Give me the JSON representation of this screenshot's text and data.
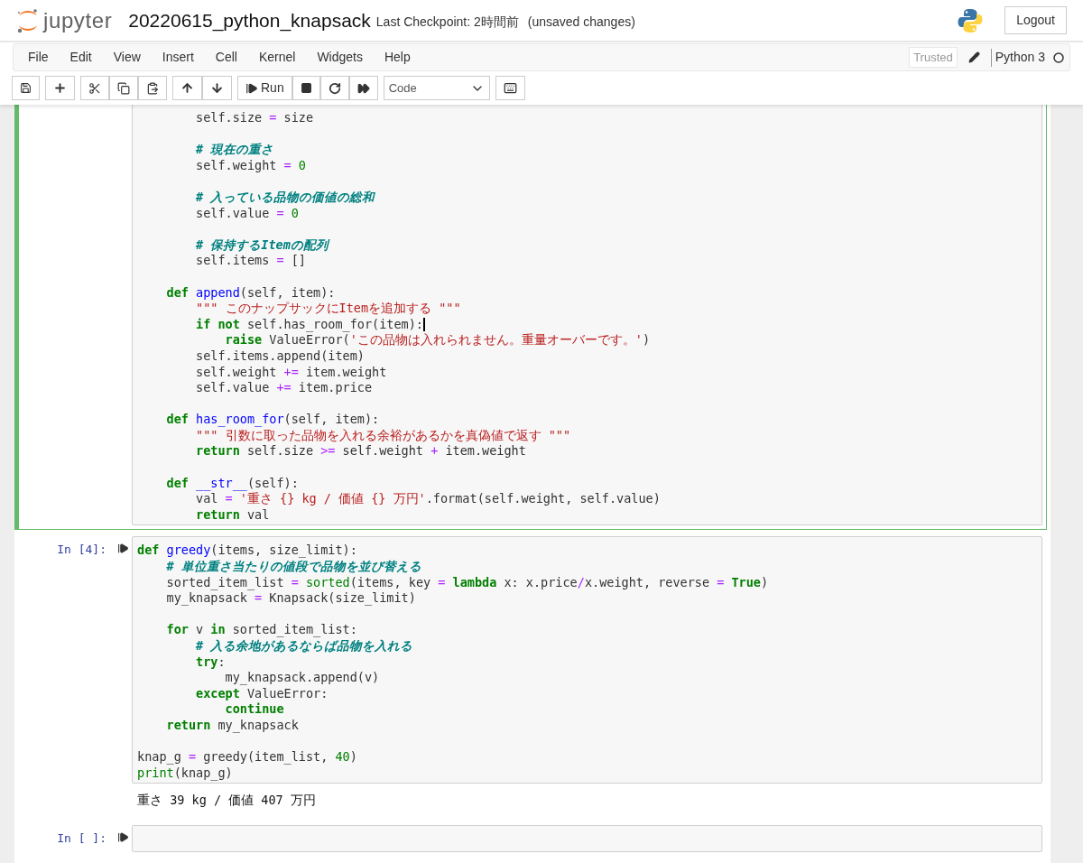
{
  "header": {
    "logo_text": "jupyter",
    "notebook_name": "20220615_python_knapsack",
    "checkpoint": "Last Checkpoint: 2時間前",
    "unsaved": "(unsaved changes)",
    "logout": "Logout"
  },
  "menu": {
    "items": [
      "File",
      "Edit",
      "View",
      "Insert",
      "Cell",
      "Kernel",
      "Widgets",
      "Help"
    ],
    "trusted": "Trusted",
    "kernel_name": "Python 3"
  },
  "toolbar": {
    "run_label": "Run",
    "cell_type": "Code"
  },
  "cells": [
    {
      "selected": true,
      "lines": [
        {
          "kind": "code",
          "tokens": [
            {
              "kind": "plain",
              "text": "        self.size "
            },
            {
              "kind": "op",
              "text": "="
            },
            {
              "kind": "plain",
              "text": " size"
            }
          ]
        },
        {
          "kind": "blank"
        },
        {
          "kind": "code",
          "tokens": [
            {
              "kind": "comment",
              "text": "        # 現在の重さ"
            }
          ]
        },
        {
          "kind": "code",
          "tokens": [
            {
              "kind": "plain",
              "text": "        self.weight "
            },
            {
              "kind": "op",
              "text": "="
            },
            {
              "kind": "num",
              "text": " 0"
            }
          ]
        },
        {
          "kind": "blank"
        },
        {
          "kind": "code",
          "tokens": [
            {
              "kind": "comment",
              "text": "        # 入っている品物の価値の総和"
            }
          ]
        },
        {
          "kind": "code",
          "tokens": [
            {
              "kind": "plain",
              "text": "        self.value "
            },
            {
              "kind": "op",
              "text": "="
            },
            {
              "kind": "num",
              "text": " 0"
            }
          ]
        },
        {
          "kind": "blank"
        },
        {
          "kind": "code",
          "tokens": [
            {
              "kind": "comment",
              "text": "        # 保持するItemの配列"
            }
          ]
        },
        {
          "kind": "code",
          "tokens": [
            {
              "kind": "plain",
              "text": "        self.items "
            },
            {
              "kind": "op",
              "text": "="
            },
            {
              "kind": "plain",
              "text": " []"
            }
          ]
        },
        {
          "kind": "blank"
        },
        {
          "kind": "code",
          "tokens": [
            {
              "kind": "kw",
              "text": "    def"
            },
            {
              "kind": "def",
              "text": " append"
            },
            {
              "kind": "plain",
              "text": "(self, item):"
            }
          ]
        },
        {
          "kind": "code",
          "tokens": [
            {
              "kind": "str",
              "text": "        \"\"\" このナップサックにItemを追加する \"\"\""
            }
          ]
        },
        {
          "kind": "code",
          "cursor": true,
          "tokens": [
            {
              "kind": "kw",
              "text": "        if"
            },
            {
              "kind": "kw",
              "text": " not"
            },
            {
              "kind": "plain",
              "text": " self.has_room_for(item):"
            }
          ]
        },
        {
          "kind": "code",
          "tokens": [
            {
              "kind": "kw",
              "text": "            raise"
            },
            {
              "kind": "plain",
              "text": " ValueError("
            },
            {
              "kind": "str",
              "text": "'この品物は入れられません。重量オーバーです。'"
            },
            {
              "kind": "plain",
              "text": ")"
            }
          ]
        },
        {
          "kind": "code",
          "tokens": [
            {
              "kind": "plain",
              "text": "        self.items.append(item)"
            }
          ]
        },
        {
          "kind": "code",
          "tokens": [
            {
              "kind": "plain",
              "text": "        self.weight "
            },
            {
              "kind": "op",
              "text": "+="
            },
            {
              "kind": "plain",
              "text": " item.weight"
            }
          ]
        },
        {
          "kind": "code",
          "tokens": [
            {
              "kind": "plain",
              "text": "        self.value "
            },
            {
              "kind": "op",
              "text": "+="
            },
            {
              "kind": "plain",
              "text": " item.price"
            }
          ]
        },
        {
          "kind": "blank"
        },
        {
          "kind": "code",
          "tokens": [
            {
              "kind": "kw",
              "text": "    def"
            },
            {
              "kind": "def",
              "text": " has_room_for"
            },
            {
              "kind": "plain",
              "text": "(self, item):"
            }
          ]
        },
        {
          "kind": "code",
          "tokens": [
            {
              "kind": "str",
              "text": "        \"\"\" 引数に取った品物を入れる余裕があるかを真偽値で返す \"\"\""
            }
          ]
        },
        {
          "kind": "code",
          "tokens": [
            {
              "kind": "kw",
              "text": "        return"
            },
            {
              "kind": "plain",
              "text": " self.size "
            },
            {
              "kind": "op",
              "text": ">="
            },
            {
              "kind": "plain",
              "text": " self.weight "
            },
            {
              "kind": "op",
              "text": "+"
            },
            {
              "kind": "plain",
              "text": " item.weight"
            }
          ]
        },
        {
          "kind": "blank"
        },
        {
          "kind": "code",
          "tokens": [
            {
              "kind": "kw",
              "text": "    def"
            },
            {
              "kind": "def",
              "text": " __str__"
            },
            {
              "kind": "plain",
              "text": "(self):"
            }
          ]
        },
        {
          "kind": "code",
          "tokens": [
            {
              "kind": "plain",
              "text": "        val "
            },
            {
              "kind": "op",
              "text": "="
            },
            {
              "kind": "str",
              "text": " '重さ {} kg / 価値 {} 万円'"
            },
            {
              "kind": "plain",
              "text": ".format(self.weight, self.value)"
            }
          ]
        },
        {
          "kind": "code",
          "tokens": [
            {
              "kind": "kw",
              "text": "        return"
            },
            {
              "kind": "plain",
              "text": " val"
            }
          ]
        }
      ]
    },
    {
      "selected": false,
      "prompt": "In [4]:",
      "output": "重さ 39 kg / 価値 407 万円",
      "lines": [
        {
          "kind": "code",
          "tokens": [
            {
              "kind": "kw",
              "text": "def"
            },
            {
              "kind": "def",
              "text": " greedy"
            },
            {
              "kind": "plain",
              "text": "(items, size_limit):"
            }
          ]
        },
        {
          "kind": "code",
          "tokens": [
            {
              "kind": "comment",
              "text": "    # 単位重さ当たりの値段で品物を並び替える"
            }
          ]
        },
        {
          "kind": "code",
          "tokens": [
            {
              "kind": "plain",
              "text": "    sorted_item_list "
            },
            {
              "kind": "op",
              "text": "="
            },
            {
              "kind": "builtin",
              "text": " sorted"
            },
            {
              "kind": "plain",
              "text": "(items, key "
            },
            {
              "kind": "op",
              "text": "="
            },
            {
              "kind": "kw",
              "text": " lambda"
            },
            {
              "kind": "plain",
              "text": " x: x.price"
            },
            {
              "kind": "op",
              "text": "/"
            },
            {
              "kind": "plain",
              "text": "x.weight, reverse "
            },
            {
              "kind": "op",
              "text": "="
            },
            {
              "kind": "kw",
              "text": " True"
            },
            {
              "kind": "plain",
              "text": ")"
            }
          ]
        },
        {
          "kind": "code",
          "tokens": [
            {
              "kind": "plain",
              "text": "    my_knapsack "
            },
            {
              "kind": "op",
              "text": "="
            },
            {
              "kind": "plain",
              "text": " Knapsack(size_limit)"
            }
          ]
        },
        {
          "kind": "blank"
        },
        {
          "kind": "code",
          "tokens": [
            {
              "kind": "kw",
              "text": "    for"
            },
            {
              "kind": "plain",
              "text": " v "
            },
            {
              "kind": "kw",
              "text": "in"
            },
            {
              "kind": "plain",
              "text": " sorted_item_list:"
            }
          ]
        },
        {
          "kind": "code",
          "tokens": [
            {
              "kind": "comment",
              "text": "        # 入る余地があるならば品物を入れる"
            }
          ]
        },
        {
          "kind": "code",
          "tokens": [
            {
              "kind": "kw",
              "text": "        try"
            },
            {
              "kind": "plain",
              "text": ":"
            }
          ]
        },
        {
          "kind": "code",
          "tokens": [
            {
              "kind": "plain",
              "text": "            my_knapsack.append(v)"
            }
          ]
        },
        {
          "kind": "code",
          "tokens": [
            {
              "kind": "kw",
              "text": "        except"
            },
            {
              "kind": "plain",
              "text": " ValueError:"
            }
          ]
        },
        {
          "kind": "code",
          "tokens": [
            {
              "kind": "kw",
              "text": "            continue"
            }
          ]
        },
        {
          "kind": "code",
          "tokens": [
            {
              "kind": "kw",
              "text": "    return"
            },
            {
              "kind": "plain",
              "text": " my_knapsack"
            }
          ]
        },
        {
          "kind": "blank"
        },
        {
          "kind": "code",
          "tokens": [
            {
              "kind": "plain",
              "text": "knap_g "
            },
            {
              "kind": "op",
              "text": "="
            },
            {
              "kind": "plain",
              "text": " greedy(item_list, "
            },
            {
              "kind": "num",
              "text": "40"
            },
            {
              "kind": "plain",
              "text": ")"
            }
          ]
        },
        {
          "kind": "code",
          "tokens": [
            {
              "kind": "builtin",
              "text": "print"
            },
            {
              "kind": "plain",
              "text": "(knap_g)"
            }
          ]
        }
      ]
    },
    {
      "selected": false,
      "prompt": "In [ ]:"
    }
  ]
}
